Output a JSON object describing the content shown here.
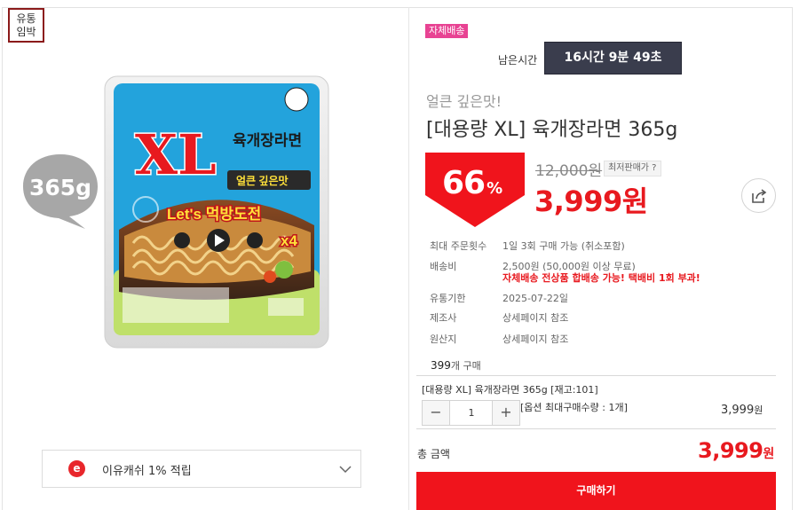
{
  "expiry_badge": "유통\n임박",
  "product_image": {
    "lid_logo": "XL",
    "lid_name": "육개장라면",
    "lid_tagline": "얼큰 깊은맛",
    "lid_challenge": "Let's 먹방도전",
    "lid_multiplier": "x4",
    "weight_bubble": "365g"
  },
  "cash_bar": {
    "icon_letter": "e",
    "text": "이유캐쉬 1% 적립"
  },
  "delivery_tag": "자체배송",
  "timer": {
    "label": "남은시간",
    "value": "16시간 9분 49초"
  },
  "product": {
    "subtitle": "얼큰 깊은맛!",
    "title": "[대용량 XL] 육개장라면 365g"
  },
  "pricing": {
    "discount": "66",
    "discount_unit": "%",
    "original_price": "12,000원",
    "min_price_tag": "최저판매가 ?",
    "sale_price": "3,999원"
  },
  "info": [
    {
      "label": "최대 주문횟수",
      "value": "1일 3회 구매 가능 (취소포함)"
    },
    {
      "label": "배송비",
      "value": "2,500원 (50,000원 이상 무료)",
      "warn": "자체배송 전상품 합배송 가능! 택배비 1회 부과!"
    },
    {
      "label": "유통기한",
      "value": "2025-07-22일"
    },
    {
      "label": "제조사",
      "value": "상세페이지 참조"
    },
    {
      "label": "원산지",
      "value": "상세페이지 참조"
    }
  ],
  "sold": {
    "count": "399",
    "unit": "개 구매"
  },
  "option": {
    "name": "[대용량 XL] 육개장라면 365g [재고:101]",
    "quantity": "1",
    "minus": "−",
    "plus": "+",
    "max_note": "[옵션 최대구매수량 : 1개]",
    "price": "3,999",
    "price_unit": "원"
  },
  "total": {
    "label": "총 금액",
    "price": "3,999",
    "unit": "원"
  },
  "buy_button": "구매하기",
  "colors": {
    "accent": "#e8191f",
    "timer_bg": "#3a3d4d",
    "tag_pink": "#e84393"
  }
}
